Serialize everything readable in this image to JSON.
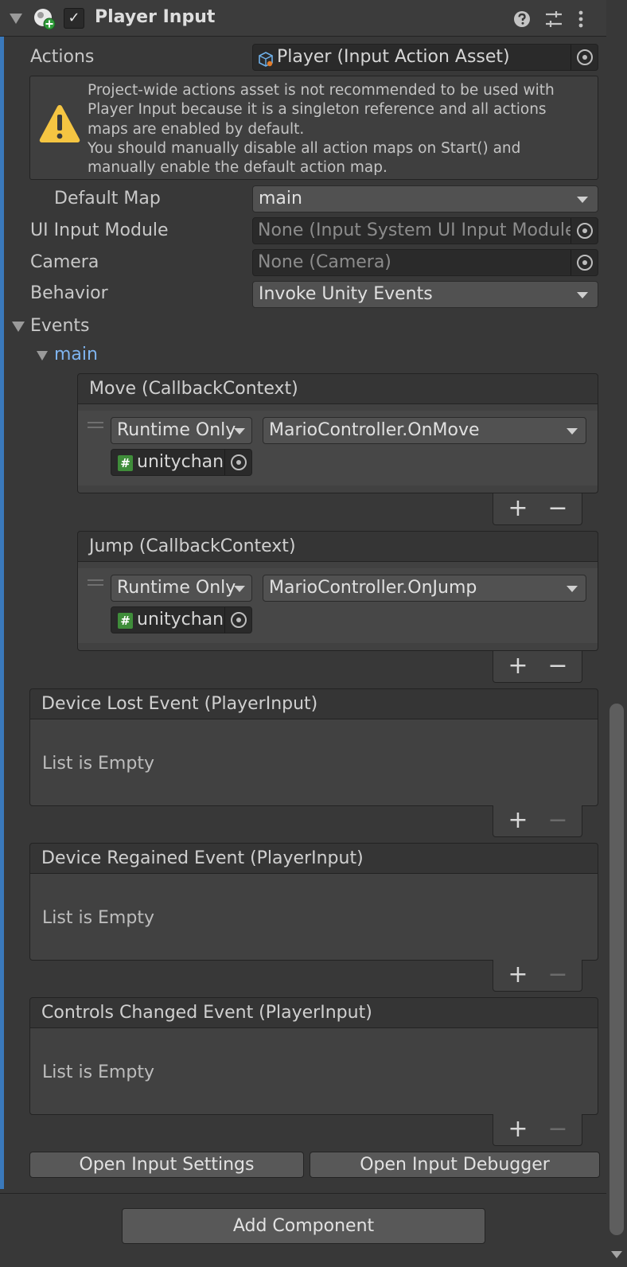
{
  "header": {
    "title": "Player Input",
    "enabled_check": "✓"
  },
  "fields": {
    "actions": {
      "label": "Actions",
      "value": "Player (Input Action Asset)"
    },
    "warning": {
      "lines": [
        "Project-wide actions asset is not recommended to be used with",
        "Player Input because it is a singleton reference and all actions",
        "maps are enabled by default.",
        "You should manually disable all action maps on Start() and",
        "manually enable the default action map."
      ]
    },
    "default_map": {
      "label": "Default Map",
      "value": "main"
    },
    "ui_input_module": {
      "label": "UI Input Module",
      "value": "None (Input System UI Input Module)"
    },
    "camera": {
      "label": "Camera",
      "value": "None (Camera)"
    },
    "behavior": {
      "label": "Behavior",
      "value": "Invoke Unity Events"
    }
  },
  "events": {
    "label": "Events",
    "map_label": "main",
    "move": {
      "title": "Move (CallbackContext)",
      "runtime": "Runtime Only",
      "function": "MarioController.OnMove",
      "target": "unitychan"
    },
    "jump": {
      "title": "Jump (CallbackContext)",
      "runtime": "Runtime Only",
      "function": "MarioController.OnJump",
      "target": "unitychan"
    },
    "device_lost": {
      "title": "Device Lost Event (PlayerInput)",
      "empty": "List is Empty"
    },
    "device_regained": {
      "title": "Device Regained Event (PlayerInput)",
      "empty": "List is Empty"
    },
    "controls_changed": {
      "title": "Controls Changed Event (PlayerInput)",
      "empty": "List is Empty"
    },
    "plus": "+",
    "minus": "−",
    "hash": "#"
  },
  "buttons": {
    "open_settings": "Open Input Settings",
    "open_debugger": "Open Input Debugger",
    "add_component": "Add Component"
  },
  "colors": {
    "accent": "#3a79bb",
    "warning": "#f5c542",
    "script_icon": "#3f8d3a"
  },
  "icons": [
    "fold-arrow-icon",
    "player-input-icon",
    "help-icon",
    "preset-sliders-icon",
    "kebab-menu-icon",
    "input-action-asset-icon",
    "warning-icon",
    "object-picker-icon",
    "caret-down-icon",
    "drag-handle-icon",
    "script-hash-icon"
  ]
}
